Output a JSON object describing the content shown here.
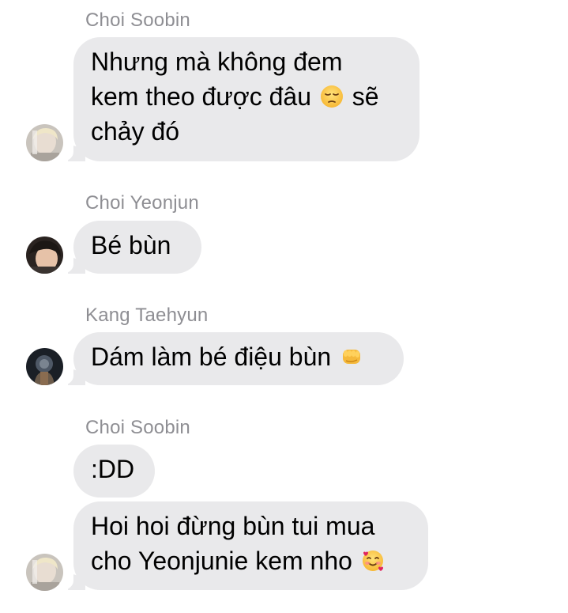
{
  "messages": [
    {
      "sender": "Choi Soobin",
      "bubbles": [
        {
          "lines": [
            "Nhưng mà không đem",
            "kem theo được đâu",
            "sẽ",
            "chảy đó"
          ]
        }
      ]
    },
    {
      "sender": "Choi Yeonjun",
      "bubbles": [
        {
          "lines": [
            "Bé bùn"
          ]
        }
      ]
    },
    {
      "sender": "Kang Taehyun",
      "bubbles": [
        {
          "lines": [
            "Dám làm bé điệu bùn"
          ]
        }
      ]
    },
    {
      "sender": "Choi Soobin",
      "bubbles": [
        {
          "lines": [
            ":DD"
          ]
        },
        {
          "lines": [
            "Hoi hoi đừng bùn tui mua",
            "cho Yeonjunie kem nho"
          ]
        }
      ]
    }
  ],
  "emojis": {
    "pensive": "pensive-face",
    "fist": "oncoming-fist",
    "hearts": "smiling-face-with-hearts"
  },
  "colors": {
    "bubble_bg": "#e9e9eb",
    "sender_text": "#8e8e93",
    "message_text": "#000000",
    "background": "#ffffff"
  }
}
